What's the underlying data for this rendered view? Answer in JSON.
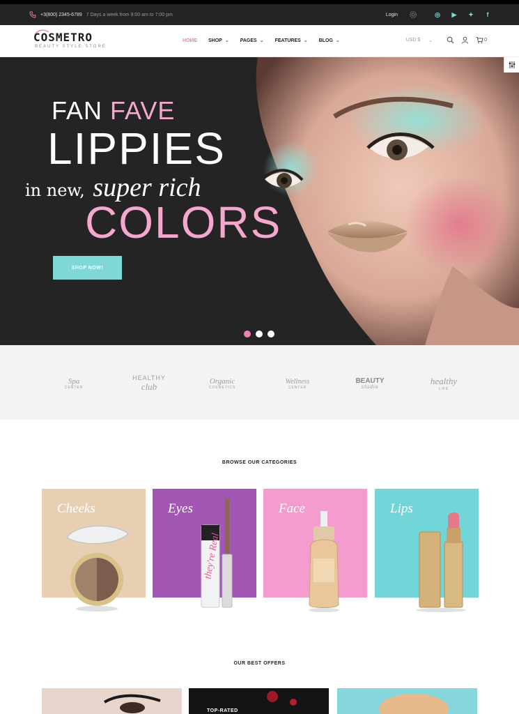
{
  "topbar": {
    "phone": "+3(800) 2345-6789",
    "hours": "7 Days a week from 9:00 am to 7:00 pm",
    "login": "Login",
    "social": [
      "instagram-icon",
      "youtube-icon",
      "twitter-icon",
      "facebook-icon"
    ]
  },
  "header": {
    "logo_name": "COSMETRO",
    "logo_tagline": "BEAUTY STYLE STORE",
    "nav": [
      {
        "label": "HOME",
        "active": true
      },
      {
        "label": "SHOP",
        "dropdown": true
      },
      {
        "label": "PAGES",
        "dropdown": true
      },
      {
        "label": "FEATURES",
        "dropdown": true
      },
      {
        "label": "BLOG",
        "dropdown": true
      }
    ],
    "currency": "USD $",
    "cart_count": "0"
  },
  "hero": {
    "line1_white": "FAN",
    "line1_pink": "FAVE",
    "line2": "LIPPIES",
    "line3_plain": "in new,",
    "line3_script": "super rich",
    "line4": "COLORS",
    "cta": "SHOP NOW!",
    "slides": 3,
    "active_slide": 1
  },
  "brands": [
    {
      "line1": "Spa",
      "line2": "CENTER"
    },
    {
      "line1": "HEALTHY",
      "line2": "club"
    },
    {
      "line1": "Organic",
      "line2": "COSMETICS"
    },
    {
      "line1": "Wellness",
      "line2": "CENTER"
    },
    {
      "line1": "BEAUTY",
      "line2": "studio"
    },
    {
      "line1": "healthy",
      "line2": "LIFE"
    }
  ],
  "categories": {
    "title": "BROWSE OUR CATEGORIES",
    "items": [
      {
        "label": "Cheeks",
        "color": "#e8cfb4"
      },
      {
        "label": "Eyes",
        "color": "#a357b5"
      },
      {
        "label": "Face",
        "color": "#f49ccd"
      },
      {
        "label": "Lips",
        "color": "#72d6d8"
      }
    ]
  },
  "offers": {
    "title": "OUR BEST OFFERS",
    "items": [
      {
        "label": ""
      },
      {
        "label": "TOP-RATED"
      },
      {
        "label": ""
      }
    ]
  },
  "colors": {
    "accent_pink": "#f27eb5",
    "accent_teal": "#7fd8d6",
    "dark": "#242424"
  }
}
